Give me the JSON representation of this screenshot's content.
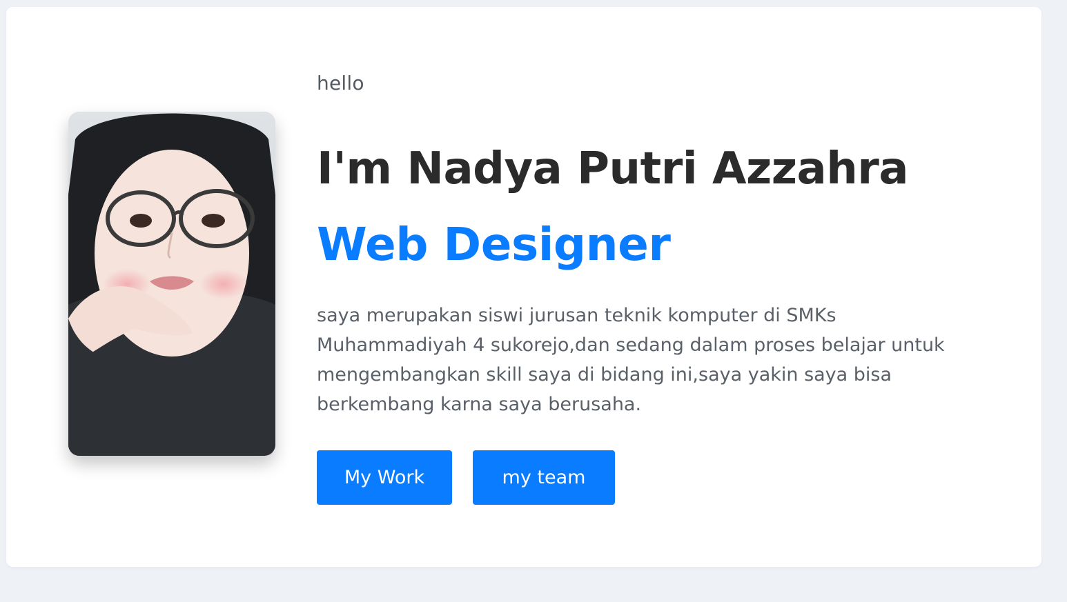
{
  "hero": {
    "greeting": "hello",
    "name": "I'm Nadya Putri Azzahra",
    "role": "Web Designer",
    "bio": "saya merupakan siswi jurusan teknik komputer di SMKs Muhammadiyah 4 sukorejo,dan sedang dalam proses belajar untuk mengembangkan skill saya di bidang ini,saya yakin saya bisa berkembang karna saya berusaha.",
    "buttons": {
      "work_label": "My Work",
      "team_label": "my team"
    }
  },
  "colors": {
    "accent": "#0a7cff",
    "heading": "#2b2b2b",
    "text": "#5a6068",
    "page_bg": "#eef2f7",
    "card_bg": "#ffffff"
  }
}
